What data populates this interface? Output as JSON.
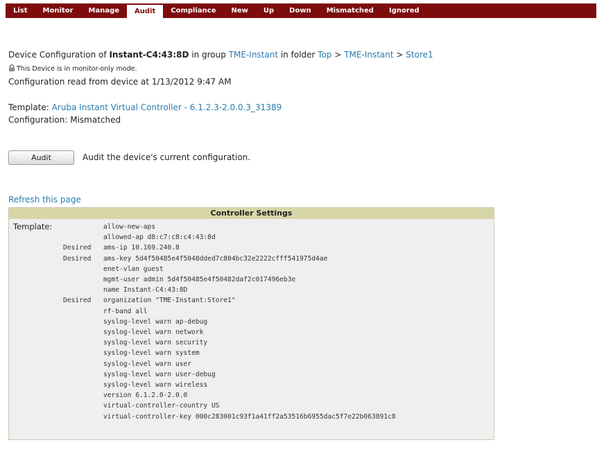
{
  "tabs": [
    {
      "label": "List",
      "active": false
    },
    {
      "label": "Monitor",
      "active": false
    },
    {
      "label": "Manage",
      "active": false
    },
    {
      "label": "Audit",
      "active": true
    },
    {
      "label": "Compliance",
      "active": false
    },
    {
      "label": "New",
      "active": false
    },
    {
      "label": "Up",
      "active": false
    },
    {
      "label": "Down",
      "active": false
    },
    {
      "label": "Mismatched",
      "active": false
    },
    {
      "label": "Ignored",
      "active": false
    }
  ],
  "device": {
    "prefix": "Device Configuration of ",
    "name": "Instant-C4:43:8D",
    "in_group": " in group ",
    "group": "TME-Instant",
    "in_folder": " in folder ",
    "folder_top": "Top",
    "sep1": " > ",
    "folder_mid": "TME-Instant",
    "sep2": " > ",
    "folder_last": "Store1",
    "monitor_note": "This Device is in monitor-only mode.",
    "config_read": "Configuration read from device at 1/13/2012 9:47 AM"
  },
  "template": {
    "label": "Template: ",
    "name": "Aruba Instant Virtual Controller - 6.1.2.3-2.0.0.3_31389",
    "config_status": "Configuration: Mismatched"
  },
  "audit": {
    "button_label": "Audit",
    "description": "Audit the device's current configuration."
  },
  "refresh_label": "Refresh this page",
  "controller_settings": {
    "title": "Controller Settings",
    "template_label": "Template:",
    "lines": [
      {
        "prefix": "",
        "text": "allow-new-aps"
      },
      {
        "prefix": "",
        "text": "allowed-ap d8:c7:c8:c4:43:8d"
      },
      {
        "prefix": "Desired",
        "text": "ams-ip 10.169.240.8"
      },
      {
        "prefix": "Desired",
        "text": "ams-key 5d4f50485e4f5048dded7c804bc32e2222cfff541975d4ae"
      },
      {
        "prefix": "",
        "text": "enet-vlan guest"
      },
      {
        "prefix": "",
        "text": "mgmt-user admin 5d4f50485e4f50482daf2c017496eb3e"
      },
      {
        "prefix": "",
        "text": "name Instant-C4:43:8D"
      },
      {
        "prefix": "Desired",
        "text": "organization \"TME-Instant:Store1\""
      },
      {
        "prefix": "",
        "text": "rf-band all"
      },
      {
        "prefix": "",
        "text": "syslog-level warn ap-debug"
      },
      {
        "prefix": "",
        "text": "syslog-level warn network"
      },
      {
        "prefix": "",
        "text": "syslog-level warn security"
      },
      {
        "prefix": "",
        "text": "syslog-level warn system"
      },
      {
        "prefix": "",
        "text": "syslog-level warn user"
      },
      {
        "prefix": "",
        "text": "syslog-level warn user-debug"
      },
      {
        "prefix": "",
        "text": "syslog-level warn wireless"
      },
      {
        "prefix": "",
        "text": "version 6.1.2.0-2.0.0"
      },
      {
        "prefix": "",
        "text": "virtual-controller-country US"
      },
      {
        "prefix": "",
        "text": "virtual-controller-key 000c283001c93f1a41ff2a53516b6955dac5f7e22b063891c8"
      }
    ]
  }
}
